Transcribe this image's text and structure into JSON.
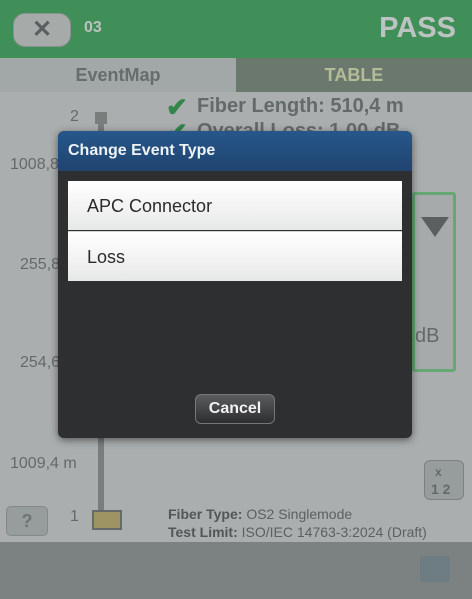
{
  "header": {
    "back_icon": "close-x-icon",
    "number": "03",
    "status": "PASS"
  },
  "tabs": [
    {
      "label": "EventMap"
    },
    {
      "label": "TABLE"
    }
  ],
  "summary": {
    "fiber_length": "Fiber Length:  510,4 m",
    "overall_loss": "Overall Loss:  1,00 dB"
  },
  "events": [
    {
      "num": "2"
    },
    {
      "num": "1"
    }
  ],
  "distances": [
    "1008,8 m",
    "255,8 m",
    "254,6 m",
    "1009,4 m"
  ],
  "panel": {
    "unit": "dB"
  },
  "help": {
    "label": "?"
  },
  "swap": {
    "top": "x",
    "bottom": "1 2"
  },
  "info": {
    "fiber_type_label": "Fiber Type:",
    "fiber_type_value": "OS2 Singlemode",
    "test_limit_label": "Test Limit:",
    "test_limit_value": "ISO/IEC 14763-3:2024 (Draft)"
  },
  "dialog": {
    "title": "Change Event Type",
    "options": [
      {
        "label": "APC Connector"
      },
      {
        "label": "Loss"
      }
    ],
    "cancel": "Cancel"
  },
  "colors": {
    "pass_green": "#34a853",
    "dialog_title_blue": "#27578a"
  }
}
